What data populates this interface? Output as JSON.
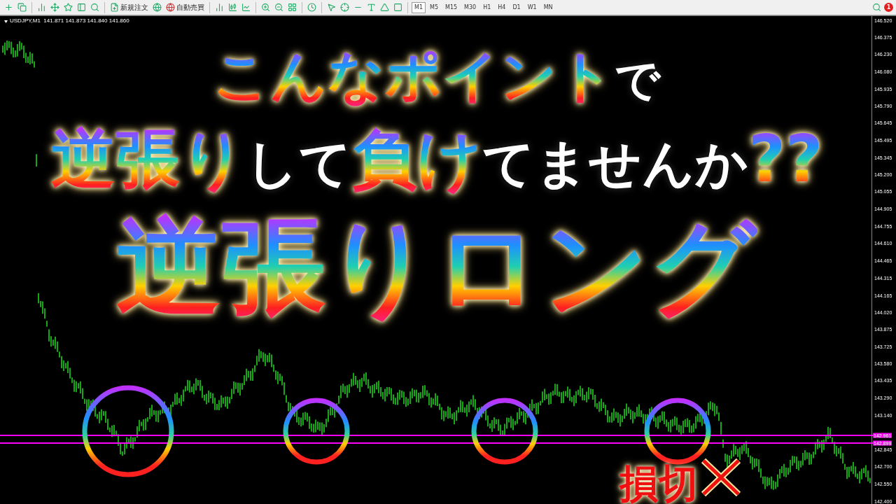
{
  "toolbar": {
    "labeled_buttons": [
      "新規注文",
      "自動売買"
    ],
    "timeframes": [
      {
        "label": "M1",
        "selected": true
      },
      {
        "label": "M5",
        "selected": false
      },
      {
        "label": "M15",
        "selected": false
      },
      {
        "label": "M30",
        "selected": false
      },
      {
        "label": "H1",
        "selected": false
      },
      {
        "label": "H4",
        "selected": false
      },
      {
        "label": "D1",
        "selected": false
      },
      {
        "label": "W1",
        "selected": false
      },
      {
        "label": "MN",
        "selected": false
      }
    ],
    "notification_count": "1"
  },
  "chart": {
    "header": "USDJPY,M1  141.871 141.873 141.840 141.860",
    "price_axis": [
      "146.520",
      "146.375",
      "146.230",
      "146.080",
      "145.935",
      "145.790",
      "145.645",
      "145.495",
      "145.345",
      "145.200",
      "145.055",
      "144.905",
      "144.755",
      "144.610",
      "144.465",
      "144.315",
      "144.165",
      "144.020",
      "143.875",
      "143.725",
      "143.580",
      "143.435",
      "143.290",
      "143.140",
      "142.845",
      "142.700",
      "142.550",
      "142.400"
    ],
    "price_lines": [
      "142.961",
      "142.899"
    ]
  },
  "headline": [
    [
      {
        "text": "こんなポイント",
        "kind": "gradient"
      },
      {
        "text": "で",
        "kind": "white"
      }
    ],
    [
      {
        "text": "逆張り",
        "kind": "gradient"
      },
      {
        "text": "して",
        "kind": "white"
      },
      {
        "text": "負け",
        "kind": "gradient"
      },
      {
        "text": "てませんか",
        "kind": "white"
      },
      {
        "text": "??",
        "kind": "gradient"
      }
    ],
    [
      {
        "text": "逆張りロング",
        "kind": "gradient"
      }
    ]
  ],
  "stop_loss_label": "損切"
}
